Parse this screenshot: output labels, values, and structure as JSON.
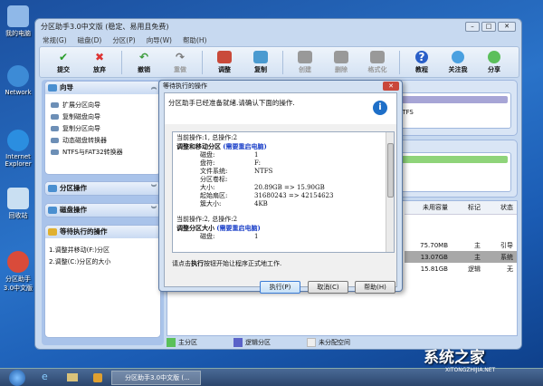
{
  "desktop": {
    "icons": [
      "我的电脑",
      "Network",
      "Internet Explorer",
      "回收站",
      "分区助手3.0中文版"
    ]
  },
  "window": {
    "title": "分区助手3.0中文版 (稳定、易用且免费)",
    "menu": [
      "常规(G)",
      "磁盘(D)",
      "分区(P)",
      "向导(W)",
      "帮助(H)"
    ],
    "toolbar": [
      {
        "label": "提交",
        "icon": "check-icon"
      },
      {
        "label": "放弃",
        "icon": "x-icon"
      },
      {
        "label": "撤销",
        "icon": "undo-icon"
      },
      {
        "label": "重做",
        "icon": "redo-icon"
      },
      {
        "label": "调整",
        "icon": "resize-icon"
      },
      {
        "label": "复制",
        "icon": "copy-icon"
      },
      {
        "label": "创建",
        "icon": "create-icon"
      },
      {
        "label": "删除",
        "icon": "delete-icon"
      },
      {
        "label": "格式化",
        "icon": "format-icon"
      },
      {
        "label": "教程",
        "icon": "help-icon"
      },
      {
        "label": "关注我",
        "icon": "follow-icon"
      },
      {
        "label": "分享",
        "icon": "share-icon"
      }
    ]
  },
  "sidebar": {
    "wizard": {
      "title": "向导",
      "items": [
        "扩展分区向导",
        "复制磁盘向导",
        "复制分区向导",
        "动态磁盘转换器",
        "NTFS与FAT32转换器"
      ]
    },
    "partition_ops": "分区操作",
    "disk_ops": "磁盘操作",
    "pending": {
      "title": "等待执行的操作",
      "items": [
        "1.调整并移动(F:)分区",
        "2.调整(C:)分区的大小"
      ]
    }
  },
  "main": {
    "disk_fs": "NTFS",
    "columns": [
      "未用容量",
      "标记",
      "状态"
    ],
    "rows": [
      [
        "75.70MB",
        "主",
        "引导"
      ],
      [
        "13.07GB",
        "主",
        "系统"
      ],
      [
        "15.81GB",
        "逻辑",
        "无"
      ]
    ],
    "legend": [
      "主分区",
      "逻辑分区",
      "未分配空间"
    ]
  },
  "dialog": {
    "title": "等待执行的操作",
    "intro": "分区助手已经准备就绪.请确认下面的操作.",
    "op1": {
      "header": "当前操作:1, 总操作:2",
      "name": "调整和移动分区",
      "note": "(需要重启电脑)",
      "fields": [
        [
          "磁盘:",
          "1"
        ],
        [
          "盘符:",
          "F:"
        ],
        [
          "文件系统:",
          "NTFS"
        ],
        [
          "分区卷标:",
          ""
        ],
        [
          "大小:",
          "20.89GB => 15.90GB"
        ],
        [
          "起始扇区:",
          "31680243 => 42154623"
        ],
        [
          "簇大小:",
          "4KB"
        ]
      ]
    },
    "op2": {
      "header": "当前操作:2, 总操作:2",
      "name": "调整分区大小",
      "note": "(需要重启电脑)",
      "fields": [
        [
          "磁盘:",
          "1"
        ]
      ]
    },
    "footer_pre": "请点击",
    "footer_bold": "执行",
    "footer_post": "按钮开始让程序正式地工作.",
    "buttons": {
      "execute": "执行(P)",
      "cancel": "取消(C)",
      "help": "帮助(H)"
    }
  },
  "taskbar": {
    "task": "分区助手3.0中文版 (..."
  },
  "watermark": {
    "main": "系统之家",
    "sub": "XITONGZHIJIA.NET"
  }
}
